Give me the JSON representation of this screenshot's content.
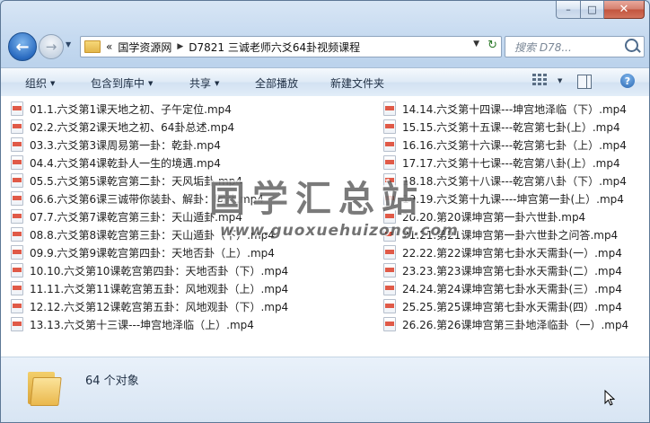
{
  "address": {
    "history_label": "«",
    "crumbs": [
      "国学资源网",
      "D7821 三诚老师六爻64卦视频课程"
    ]
  },
  "search": {
    "placeholder": "搜索 D78..."
  },
  "toolbar": {
    "organize": "组织",
    "include_library": "包含到库中",
    "share": "共享",
    "play_all": "全部播放",
    "new_folder": "新建文件夹"
  },
  "files_left": [
    "01.1.六爻第1课天地之初、子午定位.mp4",
    "02.2.六爻第2课天地之初、64卦总述.mp4",
    "03.3.六爻第3课周易第一卦：乾卦.mp4",
    "04.4.六爻第4课乾卦人一生的境遇.mp4",
    "05.5.六爻第5课乾宫第二卦：天风垢卦.mp4",
    "06.6.六爻第6课三诚带你装卦、解卦：同卦.mp4",
    "07.7.六爻第7课乾宫第三卦：天山遁卦.mp4",
    "08.8.六爻第8课乾宫第三卦：天山遁卦（下）.mp4",
    "09.9.六爻第9课乾宫第四卦：天地否卦（上）.mp4",
    "10.10.六爻第10课乾宫第四卦：天地否卦（下）.mp4",
    "11.11.六爻第11课乾宫第五卦：风地观卦（上）.mp4",
    "12.12.六爻第12课乾宫第五卦：风地观卦（下）.mp4",
    "13.13.六爻第十三课---坤宫地泽临（上）.mp4"
  ],
  "files_right": [
    "14.14.六爻第十四课---坤宫地泽临（下）.mp4",
    "15.15.六爻第十五课---乾宫第七卦(上）.mp4",
    "16.16.六爻第十六课---乾宫第七卦（上）.mp4",
    "17.17.六爻第十七课---乾宫第八卦(上）.mp4",
    "18.18.六爻第十八课---乾宫第八卦（下）.mp4",
    "19.19.六爻第十九课----坤宫第一卦(上）.mp4",
    "20.20.第20课坤宫第一卦六世卦.mp4",
    "21.21.第21课坤宫第一卦六世卦之问答.mp4",
    "22.22.第22课坤宫第七卦水天需卦(一）.mp4",
    "23.23.第23课坤宫第七卦水天需卦(二）.mp4",
    "24.24.第24课坤宫第七卦水天需卦(三）.mp4",
    "25.25.第25课坤宫第七卦水天需卦(四）.mp4",
    "26.26.第26课坤宫第三卦地泽临卦（一）.mp4"
  ],
  "watermark": {
    "title": "国学汇总站",
    "url": "www.guoxuehuizong.com"
  },
  "status": {
    "count": "64 个对象"
  }
}
